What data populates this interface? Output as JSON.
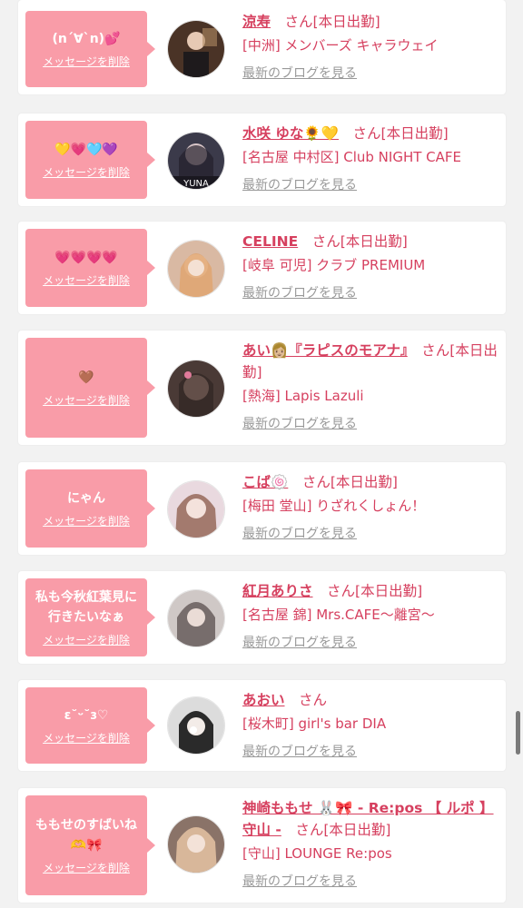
{
  "delete_label": "メッセージを削除",
  "blog_label": "最新のブログを見る",
  "san_label": "さん",
  "colors": {
    "accent": "#f99ca8",
    "name": "#d6405f",
    "muted": "#999999"
  },
  "items": [
    {
      "message": "(n´∀`n)💕",
      "name": "涼寿",
      "status": "[本日出勤]",
      "shop": "[中洲] メンバーズ キャラウェイ"
    },
    {
      "message": "💛💗🩵💜",
      "name": "水咲 ゆな🌻💛",
      "status": "[本日出勤]",
      "shop": "[名古屋 中村区] Club NIGHT CAFE"
    },
    {
      "message": "💗💗💗💗",
      "name": "CELINE",
      "status": "[本日出勤]",
      "shop": "[岐阜 可児] クラブ PREMIUM"
    },
    {
      "message": "🤎",
      "name": "あい👩🏼『ラピスのモアナ』",
      "status": "[本日出勤]",
      "shop": "[熱海] Lapis Lazuli"
    },
    {
      "message": "にゃん",
      "name": "こば🍥",
      "status": "[本日出勤]",
      "shop": "[梅田 堂山] りざれくしょん！"
    },
    {
      "message": "私も今秋紅葉見に\n行きたいなぁ",
      "name": "紅月ありさ",
      "status": "[本日出勤]",
      "shop": "[名古屋 錦] Mrs.CAFE〜離宮〜"
    },
    {
      "message": "ε˘ᵕ˘ɜ♡",
      "name": "あおい",
      "status": "",
      "shop": "[桜木町] girl's bar DIA"
    },
    {
      "message": "ももせのすばいね\n🫶🎀",
      "name": "神崎ももせ 🐰🎀 - Re:pos 【 ルポ 】 守山 -",
      "status": "[本日出勤]",
      "shop": "[守山] LOUNGE Re:pos"
    }
  ]
}
